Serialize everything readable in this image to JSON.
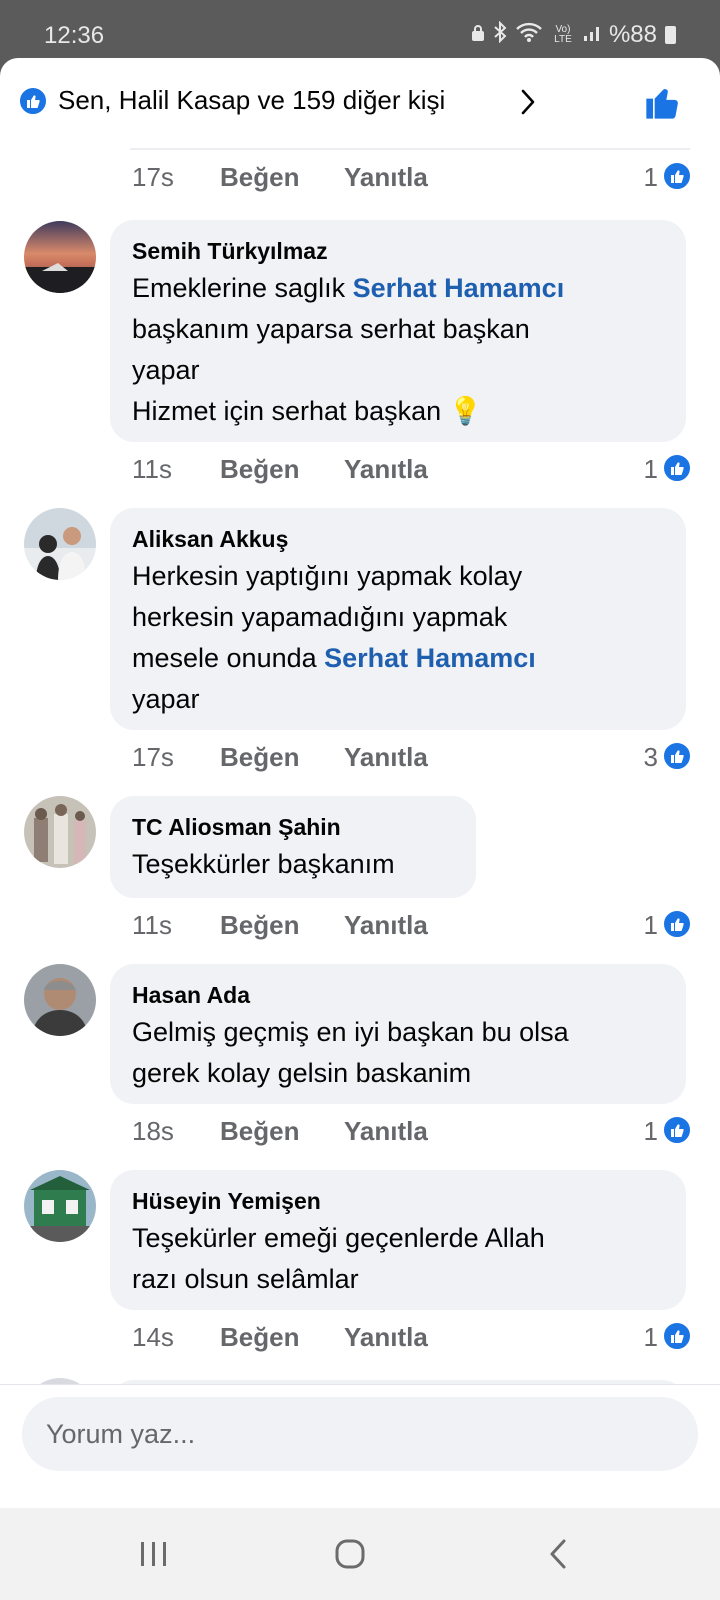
{
  "status_bar": {
    "time": "12:36",
    "battery": "%88",
    "network_label": "Vo) LTE"
  },
  "reactions": {
    "summary": "Sen, Halil Kasap ve 159 diğer kişi"
  },
  "first_row": {
    "time": "17s",
    "like_label": "Beğen",
    "reply_label": "Yanıtla",
    "reaction_count": "1"
  },
  "comments": [
    {
      "author": "Semih Türkyılmaz",
      "lines": [
        [
          {
            "t": "Emeklerine saglık "
          },
          {
            "t": "Serhat Hamamcı",
            "mention": true
          }
        ],
        [
          {
            "t": "başkanım yaparsa serhat başkan"
          }
        ],
        [
          {
            "t": "yapar"
          }
        ],
        [
          {
            "t": "Hizmet için serhat başkan 💡"
          }
        ]
      ],
      "time": "11s",
      "like_label": "Beğen",
      "reply_label": "Yanıtla",
      "reaction_count": "1"
    },
    {
      "author": "Aliksan Akkuş",
      "lines": [
        [
          {
            "t": "Herkesin yaptığını yapmak kolay"
          }
        ],
        [
          {
            "t": "herkesin yapamadığını yapmak"
          }
        ],
        [
          {
            "t": "mesele onunda "
          },
          {
            "t": "Serhat Hamamcı",
            "mention": true
          }
        ],
        [
          {
            "t": "yapar"
          }
        ]
      ],
      "time": "17s",
      "like_label": "Beğen",
      "reply_label": "Yanıtla",
      "reaction_count": "3"
    },
    {
      "author": "TC Aliosman Şahin",
      "lines": [
        [
          {
            "t": "Teşekkürler başkanım"
          }
        ]
      ],
      "time": "11s",
      "like_label": "Beğen",
      "reply_label": "Yanıtla",
      "reaction_count": "1"
    },
    {
      "author": "Hasan Ada",
      "lines": [
        [
          {
            "t": "Gelmiş geçmiş en iyi başkan bu olsa"
          }
        ],
        [
          {
            "t": "gerek kolay gelsin baskanim"
          }
        ]
      ],
      "time": "18s",
      "like_label": "Beğen",
      "reply_label": "Yanıtla",
      "reaction_count": "1"
    },
    {
      "author": "Hüseyin Yemişen",
      "lines": [
        [
          {
            "t": "Teşekürler emeği geçenlerde Allah"
          }
        ],
        [
          {
            "t": "razı olsun selâmlar"
          }
        ]
      ],
      "time": "14s",
      "like_label": "Beğen",
      "reply_label": "Yanıtla",
      "reaction_count": "1"
    }
  ],
  "composer": {
    "placeholder": "Yorum yaz..."
  },
  "colors": {
    "like_blue": "#1b74e4",
    "mention_blue": "#1f5fb0",
    "bubble_bg": "#f0f2f5",
    "meta_gray": "#65676b"
  },
  "icons": [
    "like-icon",
    "thumbs-up-icon",
    "chevron-right-icon",
    "recent-apps-icon",
    "home-icon",
    "back-icon"
  ]
}
